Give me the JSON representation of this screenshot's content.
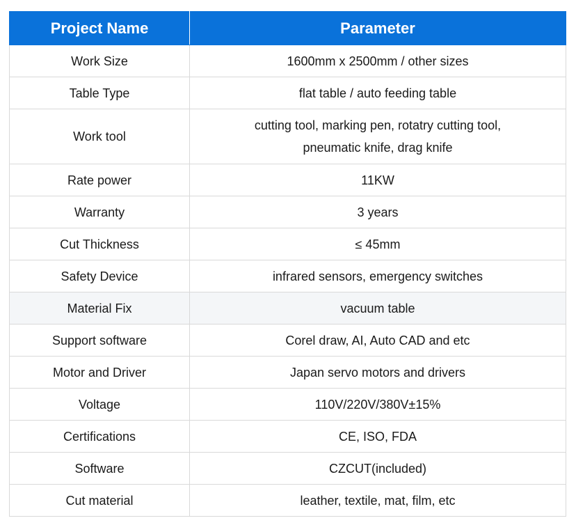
{
  "header": {
    "col1": "Project Name",
    "col2": "Parameter"
  },
  "rows": [
    {
      "name": "Work Size",
      "value": "1600mm x 2500mm / other sizes"
    },
    {
      "name": "Table Type",
      "value": "flat table / auto feeding table"
    },
    {
      "name": "Work tool",
      "value": "cutting tool, marking pen, rotatry cutting tool, pneumatic knife, drag knife"
    },
    {
      "name": "Rate power",
      "value": "11KW"
    },
    {
      "name": "Warranty",
      "value": "3 years"
    },
    {
      "name": "Cut Thickness",
      "value": "≤ 45mm"
    },
    {
      "name": "Safety Device",
      "value": "infrared sensors, emergency switches"
    },
    {
      "name": "Material Fix",
      "value": "vacuum table"
    },
    {
      "name": "Support software",
      "value": "Corel draw, AI, Auto CAD and etc"
    },
    {
      "name": "Motor and Driver",
      "value": "Japan servo motors and drivers"
    },
    {
      "name": "Voltage",
      "value": "110V/220V/380V±15%"
    },
    {
      "name": "Certifications",
      "value": "CE, ISO, FDA"
    },
    {
      "name": "Software",
      "value": "CZCUT(included)"
    },
    {
      "name": "Cut material",
      "value": "leather, textile, mat, film, etc"
    }
  ],
  "colors": {
    "header_bg": "#0a72da",
    "header_text": "#ffffff",
    "border": "#d9d9d9",
    "shaded_row": "#f4f6f8"
  }
}
